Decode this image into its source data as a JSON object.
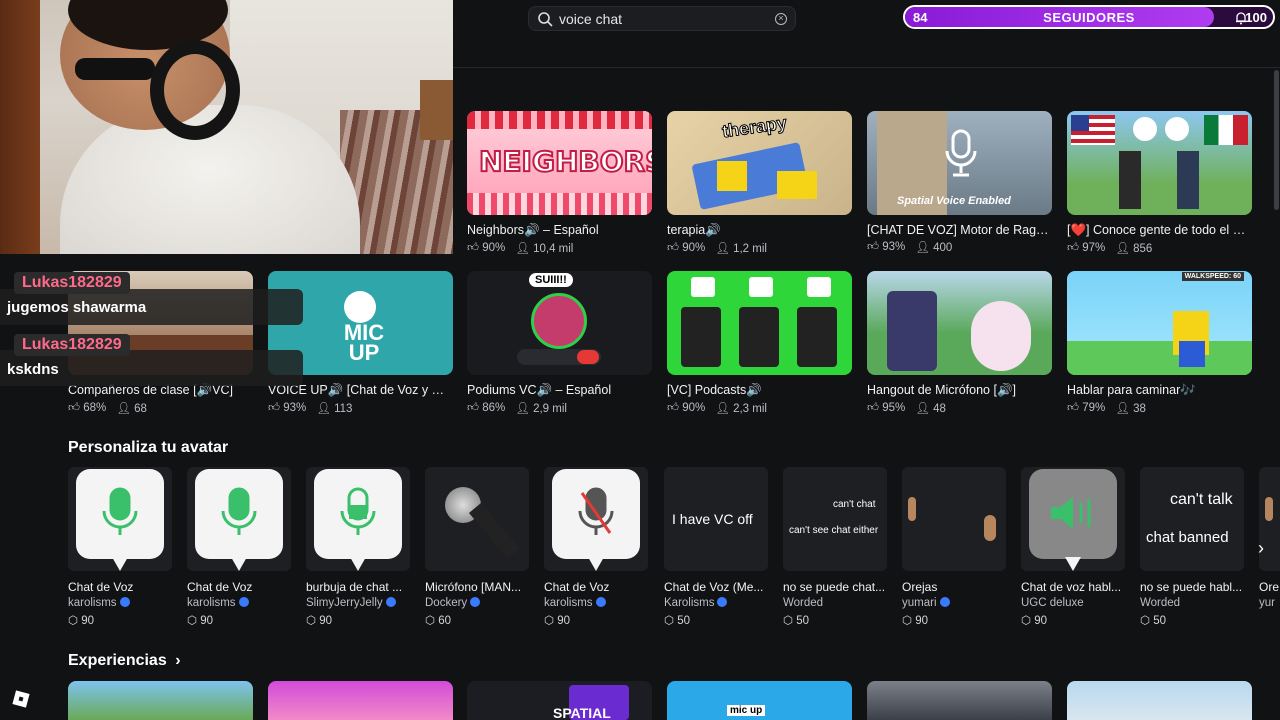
{
  "search": {
    "query": "voice chat"
  },
  "followers": {
    "current": "84",
    "label": "SEGUIDORES",
    "goal": "100",
    "progress": 0.84
  },
  "chat": [
    {
      "user": "Lukas182829",
      "message": "jugemos shawarma"
    },
    {
      "user": "Lukas182829",
      "message": "kskdns"
    }
  ],
  "games_row1": [
    {
      "title": "Neighbors🔊 – Español",
      "rating": "90%",
      "players": "10,4 mil",
      "thumb_text": "NEIGHBORS"
    },
    {
      "title": "terapia🔊",
      "rating": "90%",
      "players": "1,2 mil",
      "thumb_text": "therapy"
    },
    {
      "title": "[CHAT DE VOZ] Motor de Ragdoll",
      "rating": "93%",
      "players": "400",
      "thumb_text": "Spatial Voice Enabled"
    },
    {
      "title": "[❤️] Conoce gente de todo el m...",
      "rating": "97%",
      "players": "856",
      "thumb_text": ""
    }
  ],
  "games_row2": [
    {
      "title": "Compañeros de clase [🔊VC]",
      "rating": "68%",
      "players": "68",
      "thumb_text": ""
    },
    {
      "title": "VOICE UP🔊 [Chat de Voz y Mic...",
      "rating": "93%",
      "players": "113",
      "thumb_text": "MIC UP"
    },
    {
      "title": "Podiums VC🔊 – Español",
      "rating": "86%",
      "players": "2,9 mil",
      "thumb_text": "SUIII!!"
    },
    {
      "title": "[VC] Podcasts🔊",
      "rating": "90%",
      "players": "2,3 mil",
      "thumb_text": ""
    },
    {
      "title": "Hangout de Micrófono [🔊]",
      "rating": "95%",
      "players": "48",
      "thumb_text": ""
    },
    {
      "title": "Hablar para caminar🎶",
      "rating": "79%",
      "players": "38",
      "thumb_text": "WALKSPEED: 60"
    }
  ],
  "avatar_section": {
    "title": "Personaliza tu avatar"
  },
  "avatar_items": [
    {
      "name": "Chat de Voz",
      "creator": "karolisms",
      "verified": true,
      "price": "90",
      "kind": "mic-green"
    },
    {
      "name": "Chat de Voz",
      "creator": "karolisms",
      "verified": true,
      "price": "90",
      "kind": "mic-green"
    },
    {
      "name": "burbuja de chat ...",
      "creator": "SlimyJerryJelly",
      "verified": true,
      "price": "90",
      "kind": "mic-white"
    },
    {
      "name": "Micrófono [MAN...",
      "creator": "Dockery",
      "verified": true,
      "price": "60",
      "kind": "mic-handheld"
    },
    {
      "name": "Chat de Voz",
      "creator": "karolisms",
      "verified": true,
      "price": "90",
      "kind": "mic-muted"
    },
    {
      "name": "Chat de Voz (Me...",
      "creator": "Karolisms",
      "verified": true,
      "price": "50",
      "kind": "text",
      "text": "I have VC off"
    },
    {
      "name": "no se puede chat...",
      "creator": "Worded",
      "verified": false,
      "price": "50",
      "kind": "text2",
      "text": "can't chat",
      "text2": "can't see chat either"
    },
    {
      "name": "Orejas",
      "creator": "yumari",
      "verified": true,
      "price": "90",
      "kind": "ears"
    },
    {
      "name": "Chat de voz habl...",
      "creator": "UGC deluxe",
      "verified": false,
      "price": "90",
      "kind": "speaker"
    },
    {
      "name": "no se puede habl...",
      "creator": "Worded",
      "verified": false,
      "price": "50",
      "kind": "text2",
      "text": "can't talk",
      "text2": "chat banned"
    },
    {
      "name": "Ore",
      "creator": "yur",
      "verified": false,
      "price": "",
      "kind": "ears"
    }
  ],
  "experiences": {
    "title": "Experiencias",
    "arrow": "›",
    "thumb_texts": [
      "",
      "",
      "SPATIAL",
      "mic up",
      ""
    ]
  },
  "icons": {
    "search": "search-icon",
    "clear": "clear-icon",
    "bell": "bell-icon",
    "like": "thumbs-up-icon",
    "players": "person-icon",
    "robux": "robux-icon",
    "next": "chevron-right-icon"
  },
  "colors": {
    "background": "#111214",
    "accent": "#9b30e6",
    "verified": "#3a7bfd",
    "mic_green": "#3ac06a",
    "chat_name": "#ff6a8a"
  }
}
